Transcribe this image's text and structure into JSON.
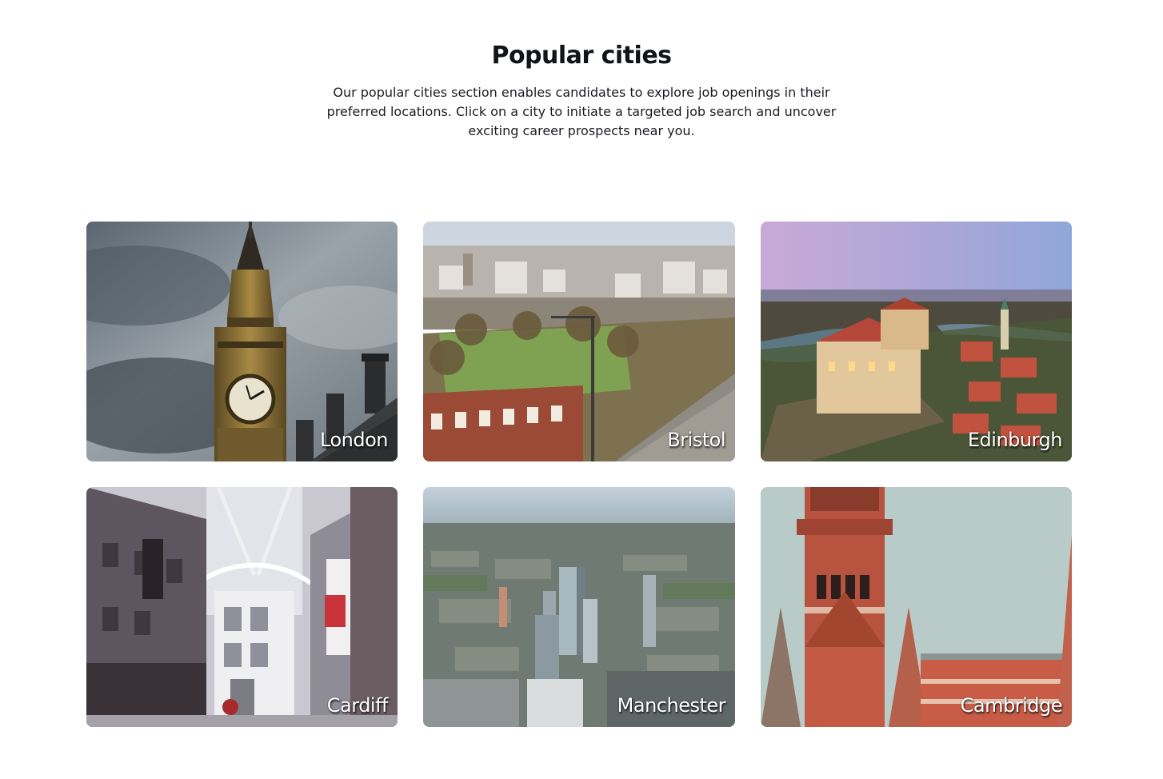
{
  "section": {
    "title": "Popular cities",
    "description": "Our popular cities section enables candidates to explore job openings in their preferred locations. Click on a city to initiate a targeted job search and uncover exciting career prospects near you."
  },
  "cities": [
    {
      "name": "London"
    },
    {
      "name": "Bristol"
    },
    {
      "name": "Edinburgh"
    },
    {
      "name": "Cardiff"
    },
    {
      "name": "Manchester"
    },
    {
      "name": "Cambridge"
    }
  ]
}
